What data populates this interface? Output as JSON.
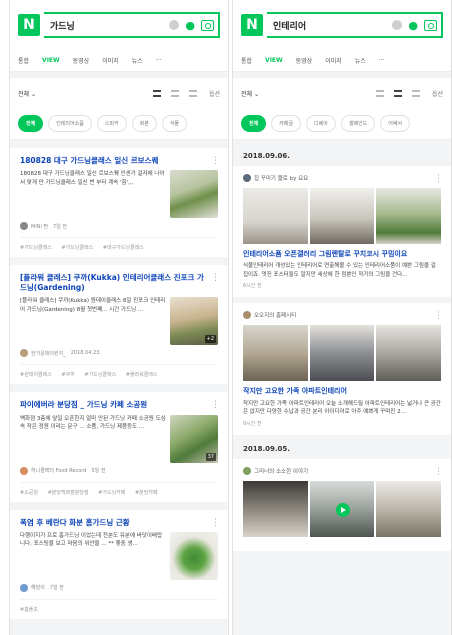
{
  "left": {
    "query": "가드닝",
    "tabs": [
      "통합",
      "VIEW",
      "동영상",
      "이미지",
      "뉴스",
      "···"
    ],
    "sort": "전체 ⌄",
    "option": "옵션",
    "chips": [
      "전체",
      "인테리어소품",
      "스피커",
      "화분",
      "식물"
    ],
    "cards": [
      {
        "title": "180828 대구 가드닝클래스 일신 르보스퀘",
        "text": "180828 대구 가드닝클래스 일신 르보스퀘 인센가 걸자에 나어서 맞게 만 가드닝클래스 일신 번 부터 계속 '힘',,,",
        "author": "MiNi 찐",
        "date": "7일 전",
        "badge": "",
        "tags": [
          "#가드닝클래스",
          "#가드닝클래스",
          "#대구가드닝클래스"
        ]
      },
      {
        "title": "[플라워 클래스] 쿠까(Kukka) 인테리어클래스 진포크 가드닝(Gardening)",
        "text": "[플라워 클래스] 쿠까(Kukka) 원데이클래스 8일 진포크 인테리어 가드닝(Gardening) 8월 첫번째... 시간 가드닝 ...",
        "author": "한가운데이런지_",
        "date": "2018.04.23.",
        "badge": "+2",
        "tags": [
          "#원데이클래스",
          "#쿠까",
          "#가드닝클래스",
          "#플라워클래스"
        ]
      },
      {
        "title": "파이에버라 분당점 _ 가드닝 카페 소공원",
        "text": "백화점 3층에 앞일 오픈한지 얼마 안된 가드닝 카페 소공원 도심 속 작은 정원 이라는 문구 ... 소품, 가드닝 제품등도 ...",
        "author": "허니콜렉터 Food Record",
        "date": "5일 전",
        "badge": "37",
        "tags": [
          "#소공원",
          "#분당백화점분당점",
          "#가드닝카페",
          "#분당카페"
        ]
      },
      {
        "title": "폭염 후 베란다 화분 홈가드닝 근황",
        "text": "다행이지가 프로 홈가드닝 이었는데 전분도 유분에 바닷이배랍니다. 포스팅을 보고 마음의 위안을 ... ** 좋중 생...",
        "author": "해담이",
        "date": "7일 전",
        "badge": "",
        "tags": [
          "#홈플초"
        ]
      }
    ]
  },
  "right": {
    "query": "인테리어",
    "tabs": [
      "통합",
      "VIEW",
      "동영상",
      "이미지",
      "뉴스",
      "···"
    ],
    "sort": "전체 ⌄",
    "option": "옵션",
    "chips": [
      "전체",
      "카페글",
      "디베아",
      "셀페인드",
      "어쎄서"
    ],
    "date1": "2018.09.06.",
    "feed1": {
      "author": "집 꾸미기 블로 by 요요",
      "title": "인테리어소품 오픈갤러리 그림렌탈로 꾸치코시 꾸밈이요",
      "desc": "식물인테리어 개성있는 인테리어로 연출해볼 수 있는 인테리어소품이 예쁜 그림을 걸 집이죠. 멋진 포스터들도 알지만 세상에 한 점뿐인 작가의 그림을 건다...",
      "date": "6시간 전"
    },
    "feed2": {
      "author": "오오지의 홈페시티",
      "title": "작지만 고요한 가족 아파트인테리어",
      "desc": "작지만 고요한 가족 아파트인테리어 오늘 소개해드릴 아파트인테리어는 넓거나 큰 공간은 없지만 다양한 수납과 공간 분리 아이디어로 아주 예쁘게 꾸며진 2...",
      "date": "9시간 전"
    },
    "date2": "2018.09.05.",
    "feed3": {
      "author": "그리너의 소소한 이야기"
    }
  }
}
